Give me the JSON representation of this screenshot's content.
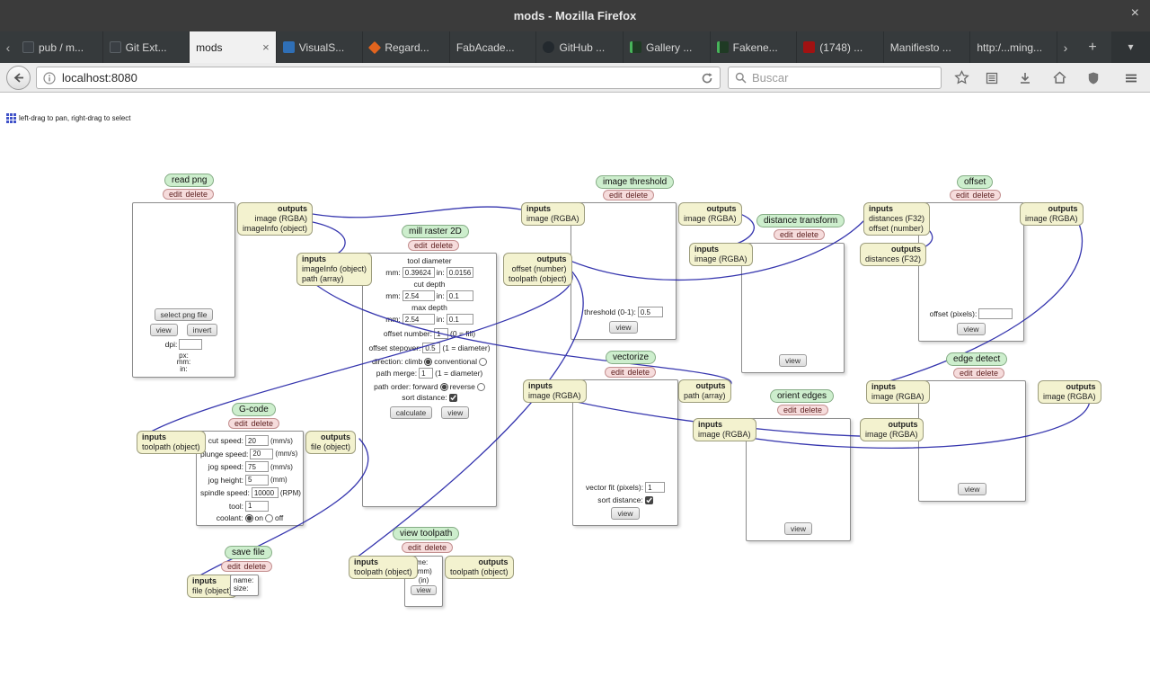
{
  "window": {
    "title": "mods - Mozilla Firefox",
    "close_glyph": "×"
  },
  "tabbar": {
    "scroll_left_glyph": "‹",
    "scroll_right_glyph": "›",
    "new_tab_glyph": "+",
    "list_tabs_glyph": "▾",
    "tabs": [
      {
        "label": "pub / m..."
      },
      {
        "label": "Git Ext..."
      },
      {
        "label": "mods",
        "close_glyph": "×"
      },
      {
        "label": "VisualS..."
      },
      {
        "label": "Regard..."
      },
      {
        "label": "FabAcade..."
      },
      {
        "label": "GitHub ..."
      },
      {
        "label": "Gallery ..."
      },
      {
        "label": "Fakene..."
      },
      {
        "label": "(1748) ..."
      },
      {
        "label": "Manifiesto ..."
      },
      {
        "label": "http:/...ming..."
      }
    ]
  },
  "toolbar": {
    "url": "localhost:8080",
    "search_placeholder": "Buscar"
  },
  "canvas_hint": "left-drag to pan, right-drag to select",
  "wire_color": "#2525a8",
  "modules": {
    "read_png": {
      "title": "read png",
      "edit": "edit",
      "delete": "delete",
      "outputs_label": "outputs",
      "outputs": [
        "image (RGBA)",
        "imageInfo (object)"
      ],
      "select_button": "select png file",
      "view_button": "view",
      "invert_button": "invert",
      "dpi_label": "dpi:",
      "dpi_value": "",
      "px_label": "px:",
      "mm_label": "mm:",
      "in_label": "in:"
    },
    "mill_raster": {
      "title": "mill raster 2D",
      "edit": "edit",
      "delete": "delete",
      "inputs_label": "inputs",
      "inputs": [
        "imageInfo (object)",
        "path (array)"
      ],
      "outputs_label": "outputs",
      "outputs": [
        "offset (number)",
        "toolpath (object)"
      ],
      "tool_diameter": {
        "heading": "tool diameter",
        "mm_label": "mm:",
        "mm_value": "0.39624",
        "in_label": "in:",
        "in_value": "0.0156"
      },
      "cut_depth": {
        "heading": "cut depth",
        "mm_label": "mm:",
        "mm_value": "2.54",
        "in_label": "in:",
        "in_value": "0.1"
      },
      "max_depth": {
        "heading": "max depth",
        "mm_label": "mm:",
        "mm_value": "2.54",
        "in_label": "in:",
        "in_value": "0.1"
      },
      "offset_number": {
        "label": "offset number:",
        "value": "1",
        "note": "(0 = fill)"
      },
      "offset_stepover": {
        "label": "offset stepover:",
        "value": "0.5",
        "note": "(1 = diameter)"
      },
      "direction": {
        "label": "direction:",
        "option1": "climb",
        "option1_checked": true,
        "option2": "conventional",
        "option2_checked": false
      },
      "path_merge": {
        "label": "path merge:",
        "value": "1",
        "note": "(1 = diameter)"
      },
      "path_order": {
        "label": "path order:",
        "option1": "forward",
        "option1_checked": true,
        "option2": "reverse",
        "option2_checked": false
      },
      "sort_distance": {
        "label": "sort distance:",
        "checked": true
      },
      "calculate_button": "calculate",
      "view_button": "view"
    },
    "image_threshold": {
      "title": "image threshold",
      "edit": "edit",
      "delete": "delete",
      "inputs_label": "inputs",
      "inputs": [
        "image (RGBA)"
      ],
      "outputs_label": "outputs",
      "outputs": [
        "image (RGBA)"
      ],
      "threshold": {
        "label": "threshold (0-1):",
        "value": "0.5"
      },
      "view_button": "view"
    },
    "distance_transform": {
      "title": "distance transform",
      "edit": "edit",
      "delete": "delete",
      "inputs_label": "inputs",
      "inputs": [
        "image (RGBA)"
      ],
      "outputs_label": "outputs",
      "outputs": [
        "distances (F32)"
      ],
      "view_button": "view"
    },
    "offset": {
      "title": "offset",
      "edit": "edit",
      "delete": "delete",
      "inputs_label": "inputs",
      "inputs": [
        "distances (F32)",
        "offset (number)"
      ],
      "outputs_label": "outputs",
      "outputs": [
        "image (RGBA)"
      ],
      "offset_pixels": {
        "label": "offset (pixels):",
        "value": ""
      },
      "view_button": "view"
    },
    "vectorize": {
      "title": "vectorize",
      "edit": "edit",
      "delete": "delete",
      "inputs_label": "inputs",
      "inputs": [
        "image (RGBA)"
      ],
      "outputs_label": "outputs",
      "outputs": [
        "path (array)"
      ],
      "vector_fit": {
        "label": "vector fit (pixels):",
        "value": "1"
      },
      "sort_distance": {
        "label": "sort distance:",
        "checked": true
      },
      "view_button": "view"
    },
    "orient_edges": {
      "title": "orient edges",
      "edit": "edit",
      "delete": "delete",
      "inputs_label": "inputs",
      "inputs": [
        "image (RGBA)"
      ],
      "outputs_label": "outputs",
      "outputs": [
        "image (RGBA)"
      ],
      "view_button": "view"
    },
    "edge_detect": {
      "title": "edge detect",
      "edit": "edit",
      "delete": "delete",
      "inputs_label": "inputs",
      "inputs": [
        "image (RGBA)"
      ],
      "outputs_label": "outputs",
      "outputs": [
        "image (RGBA)"
      ],
      "view_button": "view"
    },
    "gcode": {
      "title": "G-code",
      "edit": "edit",
      "delete": "delete",
      "inputs_label": "inputs",
      "inputs": [
        "toolpath (object)"
      ],
      "outputs_label": "outputs",
      "outputs": [
        "file (object)"
      ],
      "fields": [
        {
          "label": "cut speed:",
          "value": "20",
          "unit": "(mm/s)"
        },
        {
          "label": "plunge speed:",
          "value": "20",
          "unit": "(mm/s)"
        },
        {
          "label": "jog speed:",
          "value": "75",
          "unit": "(mm/s)"
        },
        {
          "label": "jog height:",
          "value": "5",
          "unit": "(mm)"
        },
        {
          "label": "spindle speed:",
          "value": "10000",
          "unit": "(RPM)"
        },
        {
          "label": "tool:",
          "value": "1",
          "unit": ""
        }
      ],
      "coolant": {
        "label": "coolant:",
        "option1": "on",
        "option1_checked": true,
        "option2": "off",
        "option2_checked": false
      }
    },
    "save_file": {
      "title": "save file",
      "edit": "edit",
      "delete": "delete",
      "inputs_label": "inputs",
      "inputs": [
        "file (object)"
      ],
      "name_label": "name:",
      "size_label": "size:"
    },
    "view_toolpath": {
      "title": "view toolpath",
      "edit": "edit",
      "delete": "delete",
      "inputs_label": "inputs",
      "inputs": [
        "toolpath (object)"
      ],
      "outputs_label": "outputs",
      "outputs": [
        "toolpath (object)"
      ],
      "name_label": "name:",
      "mm_label": "(mm)",
      "in_label": "(in)",
      "view_button": "view"
    }
  }
}
